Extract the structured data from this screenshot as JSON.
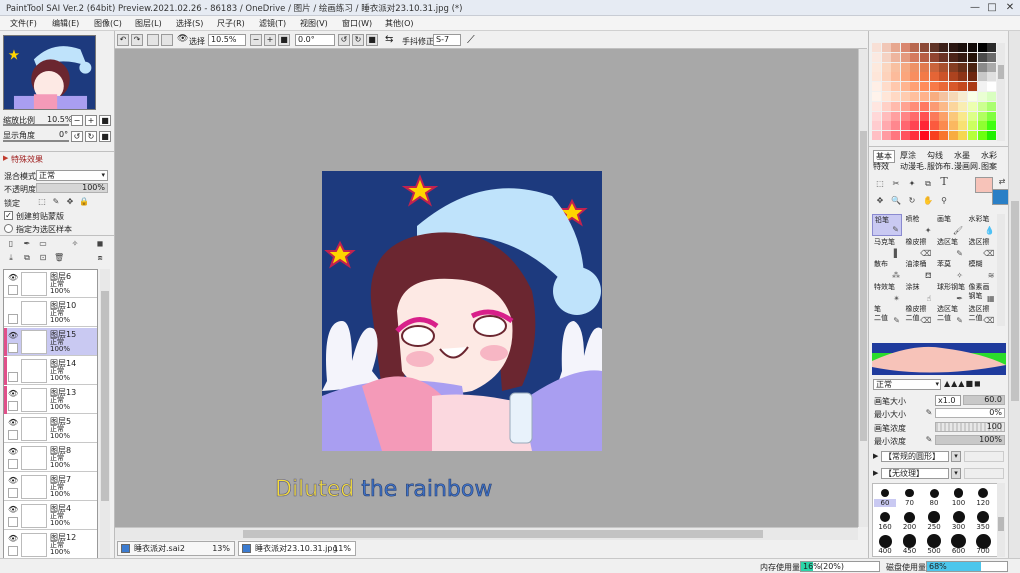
{
  "window": {
    "title": "PaintTool SAI Ver.2 (64bit) Preview.2021.02.26 - 86183 / OneDrive / 图片 / 绘画练习 / 睡衣派对23.10.31.jpg (*)",
    "min_label": "—",
    "max_label": "□",
    "close_label": "✕"
  },
  "menu": [
    "文件(F)",
    "编辑(E)",
    "图像(C)",
    "图层(L)",
    "选择(S)",
    "尺子(R)",
    "滤镜(T)",
    "视图(V)",
    "窗口(W)",
    "其他(O)"
  ],
  "navigator": {
    "zoom_label": "缩放比例",
    "zoom_value": "10.5%",
    "rotate_label": "显示角度",
    "rotate_value": "0°",
    "minus": "−",
    "plus": "+",
    "reset": "■",
    "rot_left": "↺",
    "rot_right": "↻"
  },
  "effects": {
    "header": "特殊效果",
    "blend_label": "混合模式",
    "blend_value": "正常",
    "opacity_label": "不透明度",
    "opacity_value": "100%",
    "lock_label": "锁定",
    "clip_label": "创建剪贴蒙版",
    "sel_label": "指定为选区样本"
  },
  "layers": [
    {
      "name": "图层6",
      "mode": "正常",
      "opacity": "100%",
      "selected": false,
      "pink": false,
      "visible": true
    },
    {
      "name": "图层10",
      "mode": "正常",
      "opacity": "100%",
      "selected": false,
      "pink": false,
      "visible": false
    },
    {
      "name": "图层15",
      "mode": "正常",
      "opacity": "100%",
      "selected": true,
      "pink": true,
      "visible": true
    },
    {
      "name": "图层14",
      "mode": "正常",
      "opacity": "100%",
      "selected": false,
      "pink": true,
      "visible": false
    },
    {
      "name": "图层13",
      "mode": "正常",
      "opacity": "100%",
      "selected": false,
      "pink": true,
      "visible": true
    },
    {
      "name": "图层5",
      "mode": "正常",
      "opacity": "100%",
      "selected": false,
      "pink": false,
      "visible": true
    },
    {
      "name": "图层8",
      "mode": "正常",
      "opacity": "100%",
      "selected": false,
      "pink": false,
      "visible": true
    },
    {
      "name": "图层7",
      "mode": "正常",
      "opacity": "100%",
      "selected": false,
      "pink": false,
      "visible": true
    },
    {
      "name": "图层4",
      "mode": "正常",
      "opacity": "100%",
      "selected": false,
      "pink": false,
      "visible": true
    },
    {
      "name": "图层12",
      "mode": "正常",
      "opacity": "100%",
      "selected": false,
      "pink": false,
      "visible": true
    }
  ],
  "toolbar": {
    "select_label": "选择",
    "zoom_value": "10.5%",
    "angle_value": "0.0°",
    "stabilizer_label": "手抖修正",
    "stabilizer_value": "S-7"
  },
  "canvas": {
    "caption": "Diluted the rainbow",
    "bg_color": "#1d3a7e",
    "hat_color": "#bfe3fb",
    "hair_color": "#6b2630",
    "skin_color": "#fde9e4",
    "eyebrow_color": "#d8208a",
    "pillow_purple": "#a99ef1",
    "pillow_pink": "#f49ab8"
  },
  "tabs": [
    {
      "label": "睡衣派对.sai2",
      "zoom": "13%"
    },
    {
      "label": "睡衣派对23.10.31.jpg",
      "zoom": "11%"
    }
  ],
  "status": {
    "mem_label": "内存使用量",
    "mem_value": "16%",
    "mem_paren": "(20%)",
    "mem_fraction": 0.16,
    "disk_label": "磁盘使用量",
    "disk_value": "68%",
    "disk_fraction": 0.68
  },
  "right": {
    "tool_tabs_row1": [
      "基本",
      "厚涂",
      "勾线",
      "水墨",
      "水彩"
    ],
    "tool_tabs_row2": [
      "特效",
      "动漫毛...",
      "服饰布...",
      "漫画网...",
      "图案"
    ],
    "tools": [
      {
        "a": "铅笔",
        "b": ""
      },
      {
        "a": "喷枪",
        "b": ""
      },
      {
        "a": "画笔",
        "b": ""
      },
      {
        "a": "水彩笔",
        "b": ""
      },
      {
        "a": "马克笔",
        "b": ""
      },
      {
        "a": "橡皮擦",
        "b": ""
      },
      {
        "a": "选区笔",
        "b": ""
      },
      {
        "a": "选区擦",
        "b": ""
      },
      {
        "a": "散布",
        "b": ""
      },
      {
        "a": "油漆桶",
        "b": ""
      },
      {
        "a": "苯莫",
        "b": ""
      },
      {
        "a": "模糊",
        "b": ""
      },
      {
        "a": "特效笔",
        "b": ""
      },
      {
        "a": "涂抹",
        "b": ""
      },
      {
        "a": "球形钢笔",
        "b": ""
      },
      {
        "a": "像素画",
        "b": "钢笔"
      },
      {
        "a": "笔",
        "b": "二值"
      },
      {
        "a": "橡皮擦",
        "b": "二值"
      },
      {
        "a": "选区笔",
        "b": "二值"
      },
      {
        "a": "选区擦",
        "b": "二值"
      }
    ],
    "blend_value": "正常",
    "size_label": "画笔大小",
    "size_mult": "x1.0",
    "size_value": "60.0",
    "min_size_label": "最小大小",
    "min_size_value": "0%",
    "density_label": "画笔浓度",
    "density_value": "100",
    "min_density_label": "最小浓度",
    "min_density_value": "100%",
    "shape_value": "【常规的圆形】",
    "texture_value": "【无纹理】",
    "brush_sizes": [
      "60",
      "70",
      "80",
      "100",
      "120",
      "160",
      "200",
      "250",
      "300",
      "350",
      "400",
      "450",
      "500",
      "600",
      "700"
    ],
    "selected_color": "#f7c3b9",
    "secondary_color": "#2a7fc6"
  }
}
